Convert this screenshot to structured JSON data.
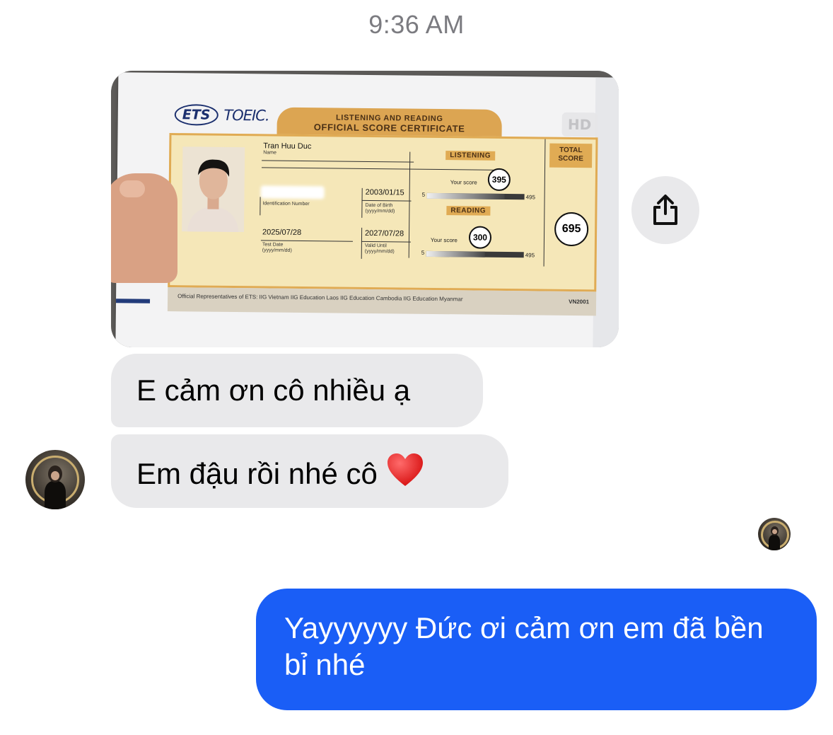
{
  "timestamp": "9:36 AM",
  "photo": {
    "hd_badge": "HD",
    "certificate": {
      "ets_logo": "ETS",
      "toeic_logo": "TOEIC.",
      "header_line1": "LISTENING AND READING",
      "header_line2": "OFFICIAL SCORE CERTIFICATE",
      "name_value": "Tran Huu Duc",
      "name_label": "Name",
      "id_label": "Identification Number",
      "dob_value": "2003/01/15",
      "dob_label": "Date of Birth (yyyy/mm/dd)",
      "test_date_value": "2025/07/28",
      "test_date_label": "Test Date (yyyy/mm/dd)",
      "valid_until_value": "2027/07/28",
      "valid_until_label": "Valid Until (yyyy/mm/dd)",
      "listening_label": "LISTENING",
      "reading_label": "READING",
      "your_score_label": "Your score",
      "listening_score": "395",
      "reading_score": "300",
      "scale_min": "5",
      "scale_max": "495",
      "listening_fraction": 0.8,
      "reading_fraction": 0.6,
      "total_label": "TOTAL SCORE",
      "total_score": "695",
      "footer_text": "Official Representatives of ETS: IIG Vietnam  IIG Education Laos  IIG Education Cambodia  IIG Education Myanmar",
      "form_code": "VN2001"
    }
  },
  "share_button": {
    "icon": "share-icon"
  },
  "messages": [
    {
      "direction": "incoming",
      "text": "E cảm ơn cô nhiều ạ"
    },
    {
      "direction": "incoming",
      "text": "Em đậu rồi nhé cô"
    },
    {
      "direction": "outgoing",
      "text": "Yayyyyyy Đức ơi cảm ơn em đã bền bỉ nhé"
    }
  ],
  "heart_emoji": "heart-icon",
  "colors": {
    "outgoing_bubble": "#1a5ef6",
    "incoming_bubble": "#e9e9eb",
    "timestamp": "#7b7b80"
  }
}
